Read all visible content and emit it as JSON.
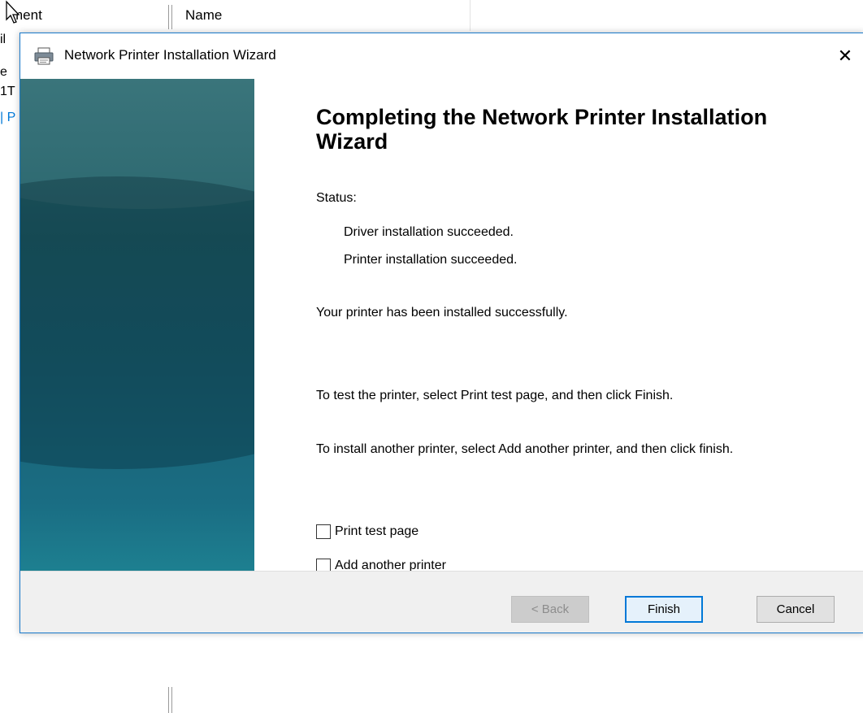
{
  "background": {
    "column_left_fragment": "ment",
    "column_name": "Name",
    "side_fragments": [
      "il",
      "e",
      "1T",
      "| P"
    ]
  },
  "dialog": {
    "title": "Network Printer Installation Wizard",
    "close_glyph": "✕",
    "heading": "Completing the Network Printer Installation Wizard",
    "status_label": "Status:",
    "status_lines": [
      "Driver installation succeeded.",
      "Printer installation succeeded."
    ],
    "success_text": "Your printer has been installed successfully.",
    "test_instruction": "To test the printer, select Print test page, and then click Finish.",
    "install_instruction": "To install another printer, select Add another printer, and then click finish.",
    "checkboxes": [
      {
        "label": "Print test page",
        "checked": false
      },
      {
        "label": "Add another printer",
        "checked": false
      }
    ],
    "buttons": {
      "back": "< Back",
      "finish": "Finish",
      "cancel": "Cancel"
    }
  },
  "colors": {
    "accent": "#0078d7",
    "banner_top": "#2e6d73",
    "banner_bottom": "#1f8a98",
    "button_bar": "#f0f0f0"
  },
  "icons": {
    "title": "printer-icon",
    "close": "close-icon",
    "cursor": "mouse-cursor-icon"
  }
}
